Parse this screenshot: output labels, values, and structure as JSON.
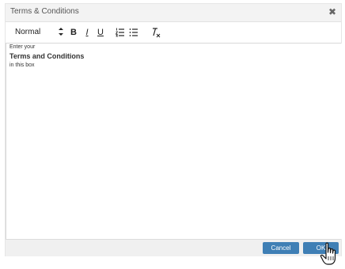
{
  "dialog": {
    "title": "Terms & Conditions",
    "close_glyph": "✖"
  },
  "toolbar": {
    "format": "Normal",
    "bold": "B",
    "italic": "I",
    "underline": "U",
    "icons": [
      "chevron-updown-icon",
      "ordered-list-icon",
      "bullet-list-icon",
      "clear-format-icon"
    ]
  },
  "editor": {
    "line1": "Enter your",
    "line2": "Terms and Conditions",
    "line3": "in this box"
  },
  "footer": {
    "cancel_label": "Cancel",
    "ok_label": "OK"
  },
  "colors": {
    "button": "#3f7fb5",
    "titlebar": "#f3f3f3",
    "footer": "#f0f0f0"
  }
}
